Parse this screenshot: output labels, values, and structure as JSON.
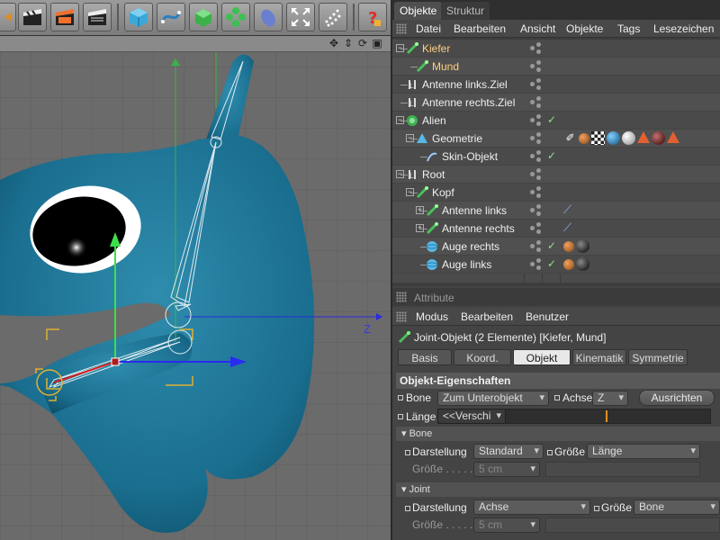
{
  "toolbar": {
    "icons": [
      "render-view-icon",
      "render-picture-viewer-icon",
      "render-settings-icon",
      "cube-primitive-icon",
      "spline-icon",
      "nurbs-icon",
      "array-icon",
      "deformer-icon",
      "scene-icon",
      "particles-icon",
      "help-icon"
    ]
  },
  "viewport": {
    "nav_icons": [
      "move-view-icon",
      "zoom-view-icon",
      "rotate-view-icon",
      "maximize-view-icon"
    ],
    "axis_label": "Z"
  },
  "objects_panel": {
    "tabs": [
      "Objekte",
      "Struktur"
    ],
    "menu": [
      "Datei",
      "Bearbeiten",
      "Ansicht",
      "Objekte",
      "Tags",
      "Lesezeichen"
    ],
    "rows": [
      {
        "name": "Kiefer",
        "indent": 1,
        "icon": "joint",
        "expander": "minus",
        "highlight": true,
        "check": false,
        "tags": []
      },
      {
        "name": "Mund",
        "indent": 2,
        "icon": "joint",
        "expander": "",
        "highlight": true,
        "check": false,
        "tags": []
      },
      {
        "name": "Antenne links.Ziel",
        "indent": 1,
        "icon": "null",
        "expander": "",
        "highlight": false,
        "check": false,
        "tags": []
      },
      {
        "name": "Antenne rechts.Ziel",
        "indent": 1,
        "icon": "null",
        "expander": "",
        "highlight": false,
        "check": false,
        "tags": []
      },
      {
        "name": "Alien",
        "indent": 1,
        "icon": "null-group",
        "expander": "minus",
        "highlight": false,
        "check": true,
        "tags": []
      },
      {
        "name": "Geometrie",
        "indent": 2,
        "icon": "geometry",
        "expander": "minus",
        "highlight": false,
        "check": false,
        "tags": [
          "phong",
          "texture",
          "checker",
          "sphere-blue",
          "sphere-white",
          "cone-orange",
          "sphere-dark",
          "cone-orange"
        ]
      },
      {
        "name": "Skin-Objekt",
        "indent": 3,
        "icon": "skin",
        "expander": "",
        "highlight": false,
        "check": true,
        "tags": []
      },
      {
        "name": "Root",
        "indent": 1,
        "icon": "null",
        "expander": "minus",
        "highlight": false,
        "check": false,
        "tags": []
      },
      {
        "name": "Kopf",
        "indent": 2,
        "icon": "joint",
        "expander": "minus",
        "highlight": false,
        "check": false,
        "tags": []
      },
      {
        "name": "Antenne links",
        "indent": 3,
        "icon": "joint",
        "expander": "plus",
        "highlight": false,
        "check": false,
        "tags": [
          "ik"
        ]
      },
      {
        "name": "Antenne rechts",
        "indent": 3,
        "icon": "joint",
        "expander": "plus",
        "highlight": false,
        "check": false,
        "tags": [
          "ik"
        ]
      },
      {
        "name": "Auge rechts",
        "indent": 3,
        "icon": "sphere",
        "expander": "",
        "highlight": false,
        "check": true,
        "tags": [
          "texture",
          "sphere-black"
        ]
      },
      {
        "name": "Auge links",
        "indent": 3,
        "icon": "sphere",
        "expander": "",
        "highlight": false,
        "check": true,
        "tags": [
          "texture",
          "sphere-black"
        ]
      }
    ]
  },
  "attributes": {
    "title": "Attribute",
    "menu": [
      "Modus",
      "Bearbeiten",
      "Benutzer"
    ],
    "header": "Joint-Objekt (2 Elemente) [Kiefer, Mund]",
    "tabs": [
      "Basis",
      "Koord.",
      "Objekt",
      "Kinematik",
      "Symmetrie"
    ],
    "active_tab": "Objekt",
    "section_title": "Objekt-Eigenschaften",
    "bone_label": "Bone",
    "bone_value": "Zum Unterobjekt",
    "achse_label": "Achse",
    "achse_value": "Z",
    "ausrichten_label": "Ausrichten",
    "laenge_label": "Länge",
    "laenge_value": "<<Verschi",
    "bone_section": "Bone",
    "joint_section": "Joint",
    "bone_darstellung_label": "Darstellung",
    "bone_darstellung_value": "Standard",
    "bone_groesse_label": "Größe",
    "bone_groesse_value": "Länge",
    "bone_groesse_field_label": "Größe . . . . .",
    "bone_groesse_field_value": "5 cm",
    "joint_darstellung_label": "Darstellung",
    "joint_darstellung_value": "Achse",
    "joint_groesse_label": "Größe",
    "joint_groesse_value": "Bone",
    "joint_groesse_field_label": "Größe . . . . .",
    "joint_groesse_field_value": "5 cm"
  }
}
